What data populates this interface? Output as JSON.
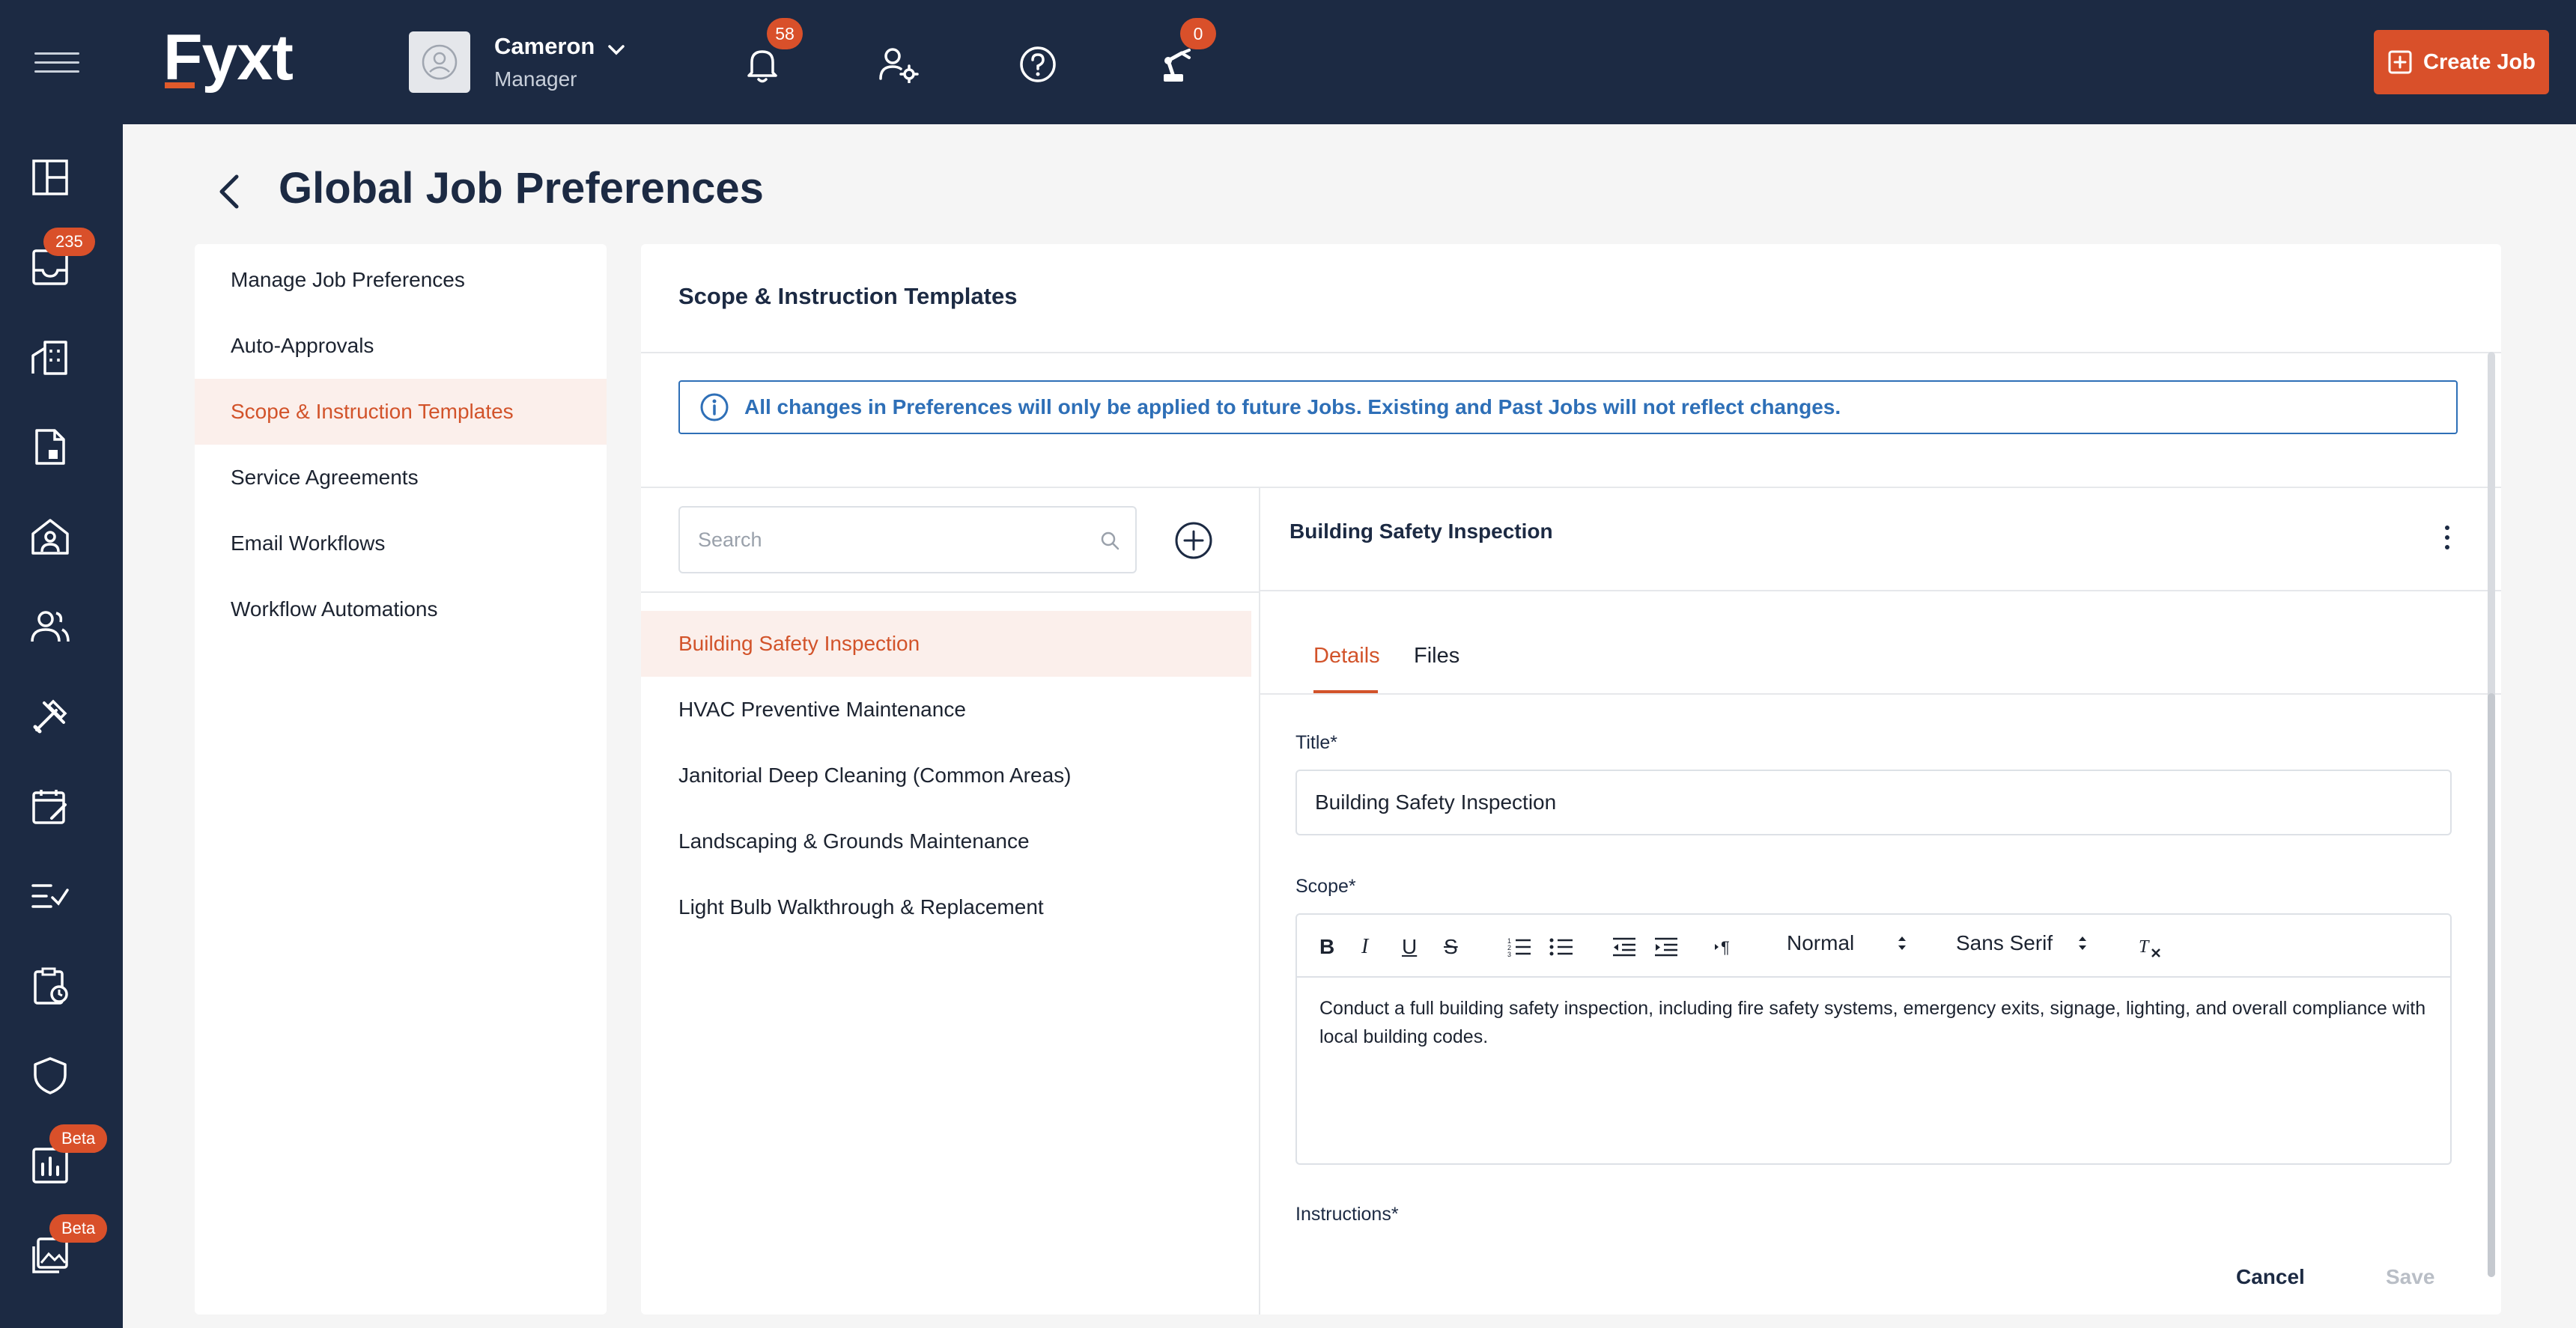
{
  "app": {
    "logo": "Fyxt",
    "user": {
      "name": "Cameron",
      "role": "Manager"
    },
    "notifications_count": "58",
    "robot_count": "0",
    "create_job_label": "Create Job"
  },
  "rail": {
    "inbox_badge": "235",
    "reports_badge": "Beta",
    "gallery_badge": "Beta"
  },
  "page": {
    "title": "Global Job Preferences"
  },
  "settings_nav": {
    "items": [
      {
        "label": "Manage Job Preferences",
        "active": false
      },
      {
        "label": "Auto-Approvals",
        "active": false
      },
      {
        "label": "Scope & Instruction Templates",
        "active": true
      },
      {
        "label": "Service Agreements",
        "active": false
      },
      {
        "label": "Email Workflows",
        "active": false
      },
      {
        "label": "Workflow Automations",
        "active": false
      }
    ]
  },
  "panel": {
    "title": "Scope & Instruction Templates",
    "info_banner": "All changes in Preferences will only be applied to future Jobs. Existing and Past Jobs will not reflect changes.",
    "search_placeholder": "Search",
    "templates": [
      {
        "label": "Building Safety Inspection",
        "active": true
      },
      {
        "label": "HVAC Preventive Maintenance",
        "active": false
      },
      {
        "label": "Janitorial Deep Cleaning (Common Areas)",
        "active": false
      },
      {
        "label": "Landscaping & Grounds Maintenance",
        "active": false
      },
      {
        "label": "Light Bulb Walkthrough & Replacement",
        "active": false
      }
    ]
  },
  "detail": {
    "header_title": "Building Safety Inspection",
    "tabs": [
      {
        "label": "Details",
        "active": true
      },
      {
        "label": "Files",
        "active": false
      }
    ],
    "title_label": "Title*",
    "title_value": "Building Safety Inspection",
    "scope_label": "Scope*",
    "toolbar": {
      "heading_select": "Normal",
      "font_select": "Sans Serif"
    },
    "scope_text": "Conduct a full building safety inspection, including fire safety systems, emergency exits, signage, lighting, and overall compliance with local building codes.",
    "instructions_label": "Instructions*",
    "cancel_label": "Cancel",
    "save_label": "Save"
  },
  "colors": {
    "navy": "#1c2a43",
    "accent": "#d9502a",
    "info_blue": "#2e6fb7",
    "active_bg": "#fbefeb"
  }
}
